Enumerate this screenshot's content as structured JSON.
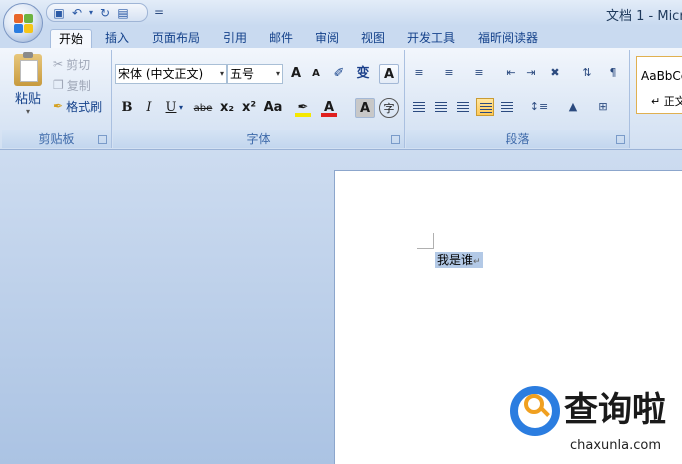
{
  "window": {
    "title": "文档 1 - Micr"
  },
  "qat": {
    "save_icon": "save-icon",
    "undo_icon": "undo-icon",
    "redo_icon": "redo-icon",
    "print_icon": "print-preview-icon",
    "customize": "="
  },
  "tabs": [
    {
      "label": "开始",
      "active": true
    },
    {
      "label": "插入"
    },
    {
      "label": "页面布局"
    },
    {
      "label": "引用"
    },
    {
      "label": "邮件"
    },
    {
      "label": "审阅"
    },
    {
      "label": "视图"
    },
    {
      "label": "开发工具"
    },
    {
      "label": "福昕阅读器"
    }
  ],
  "clipboard": {
    "paste": "粘贴",
    "cut": "剪切",
    "copy": "复制",
    "format_painter": "格式刷",
    "label": "剪贴板"
  },
  "font": {
    "name": "宋体 (中文正文)",
    "size": "五号",
    "label": "字体",
    "grow": "A",
    "shrink": "A",
    "bold": "B",
    "italic": "I",
    "underline": "U",
    "strike": "abe",
    "sub": "x₂",
    "sup": "x²",
    "case": "Aa",
    "highlight": "ab",
    "color": "A",
    "phonetic": "变",
    "border": "A",
    "shade": "A",
    "enclose": "字"
  },
  "paragraph": {
    "label": "段落"
  },
  "styles": {
    "sample": "AaBbCc",
    "name": "↵ 正文"
  },
  "document": {
    "text": "我是谁",
    "para_mark": "↵"
  },
  "watermark": {
    "brand": "查询啦",
    "url": "chaxunla.com"
  },
  "colors": {
    "ribbon_top": "#f2f6fc",
    "accent": "#15428b",
    "selection": "#b3c9e6",
    "highlight_yellow": "#ffc957"
  }
}
